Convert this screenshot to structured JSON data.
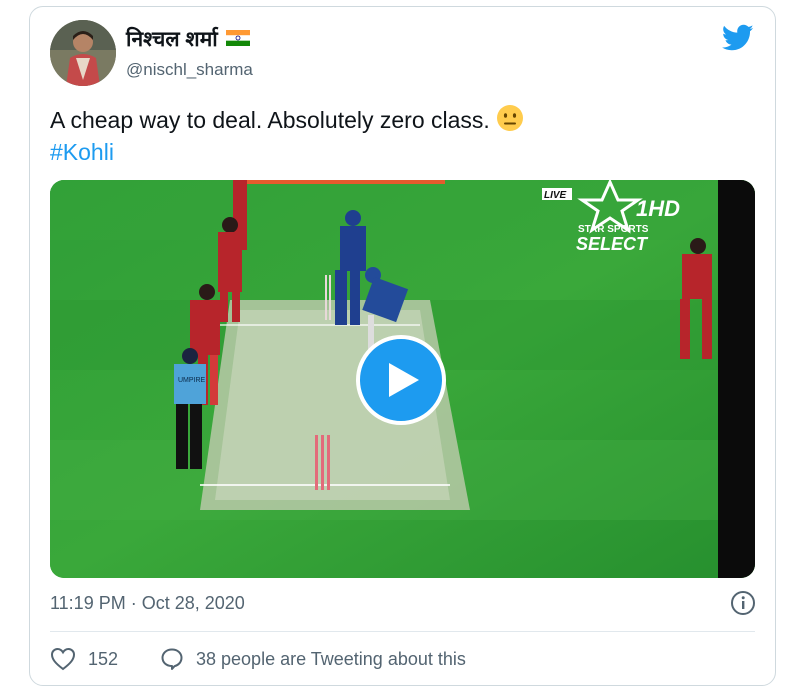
{
  "tweet": {
    "display_name": "निश्चल शर्मा",
    "handle": "@nischl_sharma",
    "text": "A cheap way to deal. Absolutely zero class.",
    "hashtag": "#Kohli",
    "emoji": "neutral-face-emoji",
    "timestamp": "11:19 PM · Oct 28, 2020",
    "like_count": "152",
    "reply_text": "38 people are Tweeting about this"
  },
  "media": {
    "broadcast_live": "LIVE",
    "broadcast_channel": "1HD",
    "broadcast_brand": "STAR SPORTS",
    "broadcast_select": "SELECT",
    "umpire_label": "UMPIRE"
  },
  "colors": {
    "accent": "#1d9bf0",
    "muted_text": "#536471",
    "border": "#cfd9de",
    "pitch_green": "#2e9d35"
  },
  "icons": [
    "twitter-bird-icon",
    "india-flag-icon",
    "play-icon",
    "info-icon",
    "heart-icon",
    "speech-bubble-icon"
  ]
}
